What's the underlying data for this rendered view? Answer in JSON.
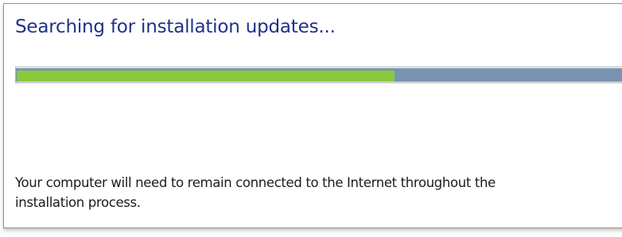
{
  "dialog": {
    "title": "Searching for installation updates...",
    "progress": {
      "fraction": 0.62,
      "fill_color": "#8cc83c",
      "track_color": "#7894b0"
    },
    "message": "Your computer will need to remain connected to the Internet throughout the\ninstallation process."
  }
}
